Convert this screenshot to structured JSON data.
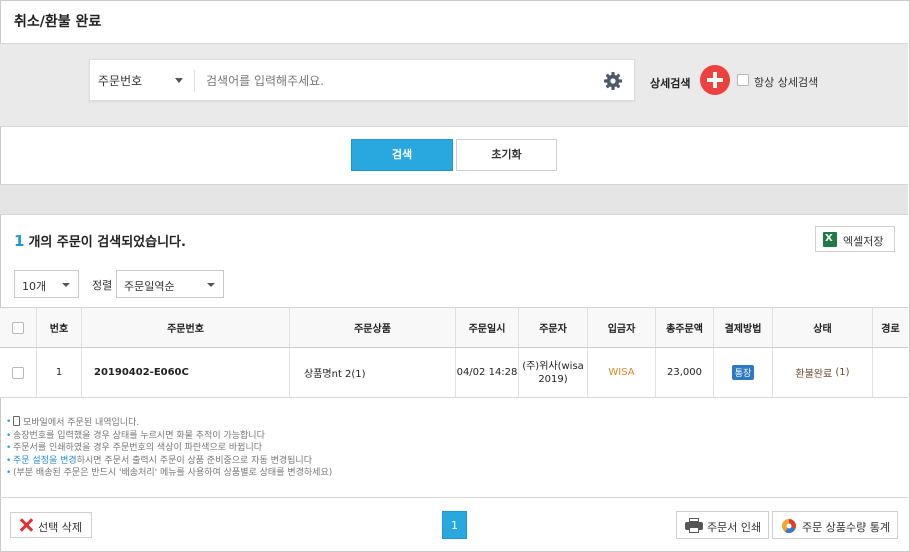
{
  "page": {
    "title": "취소/환불 완료"
  },
  "search": {
    "field": "주문번호",
    "placeholder": "검색어를 입력해주세요.",
    "detail_label": "상세검색",
    "always_detail_label": "항상 상세검색"
  },
  "buttons": {
    "search": "검색",
    "reset": "초기화"
  },
  "results": {
    "count": "1",
    "count_suffix": "개의 주문이 검색되었습니다.",
    "excel_label": "엑셀저장"
  },
  "filters": {
    "page_size": "10개",
    "sort_label": "정렬",
    "sort_value": "주문일역순"
  },
  "table": {
    "headers": [
      "번호",
      "주문번호",
      "주문상품",
      "주문일시",
      "주문자",
      "입금자",
      "총주문액",
      "결제방법",
      "상태",
      "경로"
    ],
    "rows": [
      {
        "no": "1",
        "order_no": "20190402-E060C",
        "product": "상품명nt 2(1)",
        "date": "04/02 14:28",
        "buyer_line1": "(주)위사(wisa",
        "buyer_line2": "2019)",
        "depositor": "WISA",
        "total": "23,000",
        "payment": "통장",
        "status": "환불완료",
        "status_count": "(1)"
      }
    ]
  },
  "notes": {
    "mobile": "모바일에서 주문된 내역입니다.",
    "tracking": "송장번호를 입력했을 경우 상태를 누르시면 화물 추적이 가능합니다",
    "printed": "주문서를 인쇄하였을 경우 주문번호의 색상이 파란색으로 바뀝니다",
    "setting_link": "주문 설정을 변경",
    "setting_rest": "하시면 주문서 출력시 주문이 상품 준비중으로 자동 변경됩니다",
    "partial": "(부분 배송된 주문은 반드시 '배송처리' 메뉴를 사용하여 상품별로 상태를 변경하세요)"
  },
  "footer": {
    "delete_label": "선택 삭제",
    "page": "1",
    "print_label": "주문서 인쇄",
    "stats_label": "주문 상품수량 통계"
  },
  "colors": {
    "accent": "#29a8df",
    "danger": "#ef4040",
    "depositor": "#e0862a",
    "excel": "#1f7a43"
  }
}
